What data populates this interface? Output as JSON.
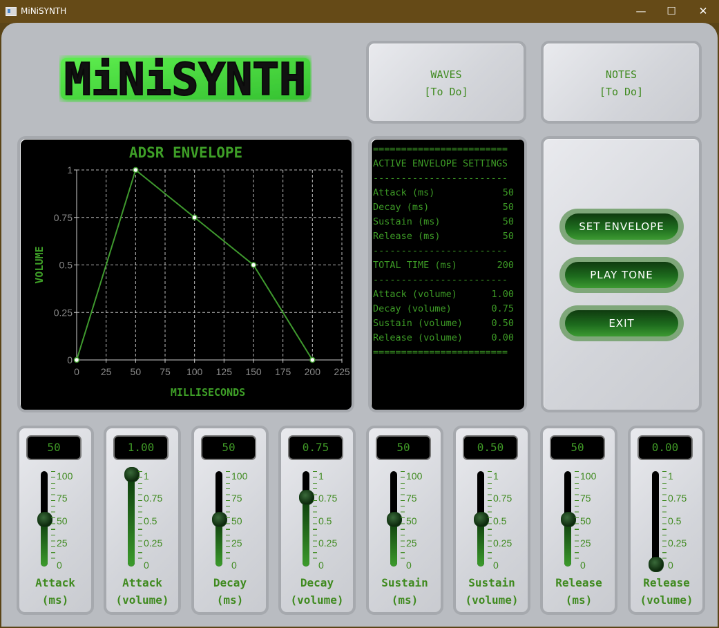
{
  "window": {
    "title": "MiNiSYNTH",
    "controls": {
      "minimize": "—",
      "maximize": "☐",
      "close": "✕"
    }
  },
  "logo": {
    "text": "MiNiSYNTH"
  },
  "waves": {
    "title": "WAVES",
    "status": "[To Do]"
  },
  "notes": {
    "title": "NOTES",
    "status": "[To Do]"
  },
  "chart_data": {
    "type": "line",
    "title": "ADSR ENVELOPE",
    "xlabel": "MILLISECONDS",
    "ylabel": "VOLUME",
    "x": [
      0,
      50,
      100,
      150,
      200
    ],
    "y": [
      0,
      1,
      0.75,
      0.5,
      0
    ],
    "xlim": [
      0,
      225
    ],
    "ylim": [
      0,
      1
    ],
    "xticks": [
      0,
      25,
      50,
      75,
      100,
      125,
      150,
      175,
      200,
      225
    ],
    "yticks": [
      0,
      0.25,
      0.5,
      0.75,
      1
    ],
    "yticklabels": [
      "0",
      "0.25",
      "0.5",
      "0.75",
      "1"
    ],
    "grid": true,
    "colors": {
      "line": "#3f9a2e",
      "grid": "#bdbdbd",
      "axis": "#cfcfcf",
      "title": "#3e9f27"
    }
  },
  "settings": {
    "separator": "========================",
    "divider": "------------------------",
    "heading": "ACTIVE ENVELOPE SETTINGS",
    "times": [
      {
        "label": "Attack (ms)",
        "value": "50"
      },
      {
        "label": "Decay (ms)",
        "value": "50"
      },
      {
        "label": "Sustain (ms)",
        "value": "50"
      },
      {
        "label": "Release (ms)",
        "value": "50"
      }
    ],
    "total": {
      "label": "TOTAL TIME (ms)",
      "value": "200"
    },
    "volumes": [
      {
        "label": "Attack (volume)",
        "value": "1.00"
      },
      {
        "label": "Decay (volume)",
        "value": "0.75"
      },
      {
        "label": "Sustain (volume)",
        "value": "0.50"
      },
      {
        "label": "Release (volume)",
        "value": "0.00"
      }
    ]
  },
  "buttons": {
    "set_envelope": "SET ENVELOPE",
    "play_tone": "PLAY TONE",
    "exit": "EXIT"
  },
  "sliders": [
    {
      "value_text": "50",
      "value": 50,
      "max": 100,
      "line1": "Attack",
      "line2": "(ms)",
      "ticks": [
        "100",
        "75",
        "50",
        "25",
        "0"
      ]
    },
    {
      "value_text": "1.00",
      "value": 1.0,
      "max": 1,
      "line1": "Attack",
      "line2": "(volume)",
      "ticks": [
        "1",
        "0.75",
        "0.5",
        "0.25",
        "0"
      ]
    },
    {
      "value_text": "50",
      "value": 50,
      "max": 100,
      "line1": "Decay",
      "line2": "(ms)",
      "ticks": [
        "100",
        "75",
        "50",
        "25",
        "0"
      ]
    },
    {
      "value_text": "0.75",
      "value": 0.75,
      "max": 1,
      "line1": "Decay",
      "line2": "(volume)",
      "ticks": [
        "1",
        "0.75",
        "0.5",
        "0.25",
        "0"
      ]
    },
    {
      "value_text": "50",
      "value": 50,
      "max": 100,
      "line1": "Sustain",
      "line2": "(ms)",
      "ticks": [
        "100",
        "75",
        "50",
        "25",
        "0"
      ]
    },
    {
      "value_text": "0.50",
      "value": 0.5,
      "max": 1,
      "line1": "Sustain",
      "line2": "(volume)",
      "ticks": [
        "1",
        "0.75",
        "0.5",
        "0.25",
        "0"
      ]
    },
    {
      "value_text": "50",
      "value": 50,
      "max": 100,
      "line1": "Release",
      "line2": "(ms)",
      "ticks": [
        "100",
        "75",
        "50",
        "25",
        "0"
      ]
    },
    {
      "value_text": "0.00",
      "value": 0.0,
      "max": 1,
      "line1": "Release",
      "line2": "(volume)",
      "ticks": [
        "1",
        "0.75",
        "0.5",
        "0.25",
        "0"
      ]
    }
  ]
}
